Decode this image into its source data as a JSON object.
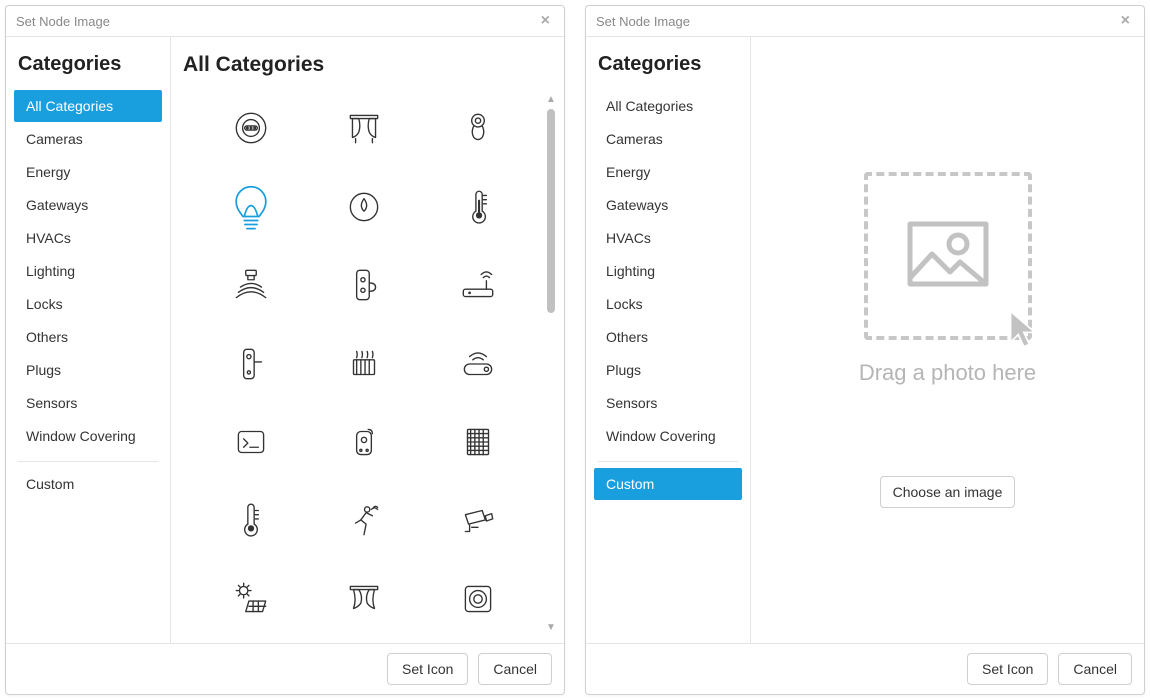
{
  "dialog_left": {
    "title": "Set Node Image",
    "sidebar_heading": "Categories",
    "content_heading": "All Categories",
    "active_category": "All Categories",
    "categories": [
      {
        "label": "All Categories"
      },
      {
        "label": "Cameras"
      },
      {
        "label": "Energy"
      },
      {
        "label": "Gateways"
      },
      {
        "label": "HVACs"
      },
      {
        "label": "Lighting"
      },
      {
        "label": "Locks"
      },
      {
        "label": "Others"
      },
      {
        "label": "Plugs"
      },
      {
        "label": "Sensors"
      },
      {
        "label": "Window Covering"
      }
    ],
    "custom_label": "Custom",
    "icons_visible": [
      {
        "name": "vacuum-robot-icon"
      },
      {
        "name": "curtain-icon"
      },
      {
        "name": "dial-icon"
      },
      {
        "name": "bulb-outline-icon",
        "selected": true
      },
      {
        "name": "water-drop-icon"
      },
      {
        "name": "thermometer-icon"
      },
      {
        "name": "motion-sensor-icon"
      },
      {
        "name": "door-lock-icon"
      },
      {
        "name": "router-icon"
      },
      {
        "name": "door-handle-icon"
      },
      {
        "name": "radiator-icon"
      },
      {
        "name": "smart-plug-icon"
      },
      {
        "name": "terminal-icon"
      },
      {
        "name": "remote-icon"
      },
      {
        "name": "blinds-icon"
      },
      {
        "name": "thermometer2-icon"
      },
      {
        "name": "running-icon"
      },
      {
        "name": "camera-icon"
      },
      {
        "name": "solar-panel-icon"
      },
      {
        "name": "curtain2-icon"
      },
      {
        "name": "switch-frame-icon"
      }
    ],
    "footer": {
      "set_label": "Set Icon",
      "cancel_label": "Cancel"
    }
  },
  "dialog_right": {
    "title": "Set Node Image",
    "sidebar_heading": "Categories",
    "active_category": "Custom",
    "categories": [
      {
        "label": "All Categories"
      },
      {
        "label": "Cameras"
      },
      {
        "label": "Energy"
      },
      {
        "label": "Gateways"
      },
      {
        "label": "HVACs"
      },
      {
        "label": "Lighting"
      },
      {
        "label": "Locks"
      },
      {
        "label": "Others"
      },
      {
        "label": "Plugs"
      },
      {
        "label": "Sensors"
      },
      {
        "label": "Window Covering"
      }
    ],
    "custom_label": "Custom",
    "drop_text": "Drag a photo here",
    "choose_label": "Choose an image",
    "footer": {
      "set_label": "Set Icon",
      "cancel_label": "Cancel"
    }
  }
}
